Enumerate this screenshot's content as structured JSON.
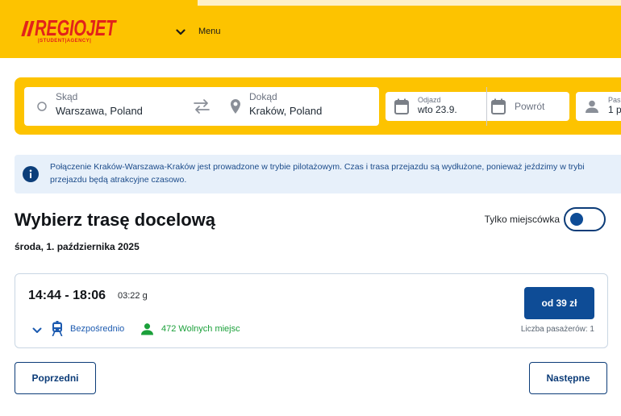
{
  "header": {
    "logo": {
      "regio": "REGIO",
      "jet": "JET",
      "tagline": "|STUDENT|AGENCY|"
    },
    "menu_label": "Menu"
  },
  "search": {
    "from": {
      "label": "Skąd",
      "value": "Warszawa, Poland"
    },
    "to": {
      "label": "Dokąd",
      "value": "Kraków, Poland"
    },
    "departure": {
      "label": "Odjazd",
      "value": "wto 23.9."
    },
    "return": {
      "placeholder": "Powrót"
    },
    "passengers": {
      "label": "Pas",
      "value": "1 p"
    }
  },
  "info": {
    "line1": "Połączenie Kraków-Warszawa-Kraków jest prowadzone w trybie pilotażowym. Czas i trasa przejazdu są wydłużone, ponieważ jeździmy w trybi",
    "line2": "przejazdu będą atrakcyjne czasowo."
  },
  "main": {
    "title": "Wybierz trasę docelową",
    "date": "środa, 1. października 2025",
    "toggle": {
      "label": "Tylko miejscówka",
      "on": false
    }
  },
  "connection": {
    "time": "14:44 - 18:06",
    "duration": "03:22 g",
    "type": "Bezpośrednio",
    "seats": "472 Wolnych miejsc",
    "price_button": "od 39 zł",
    "passengers": "Liczba pasażerów: 1"
  },
  "pagination": {
    "prev": "Poprzedni",
    "next": "Następne"
  },
  "icons": {
    "menu": "chevron-down-icon",
    "from": "circle-icon",
    "swap": "swap-arrows-icon",
    "to": "location-pin-icon",
    "departure": "calendar-icon",
    "return": "calendar-icon",
    "passengers": "person-icon",
    "info": "info-icon",
    "expand": "chevron-down-icon",
    "connection_type": "bus-icon",
    "seats": "person-icon"
  },
  "colors": {
    "brand_yellow": "#FDC300",
    "brand_red": "#E2231A",
    "brand_blue": "#0E4C96",
    "link_blue": "#1D5BB0",
    "success_green": "#1BA03A",
    "info_bg": "#E7F0FA"
  }
}
